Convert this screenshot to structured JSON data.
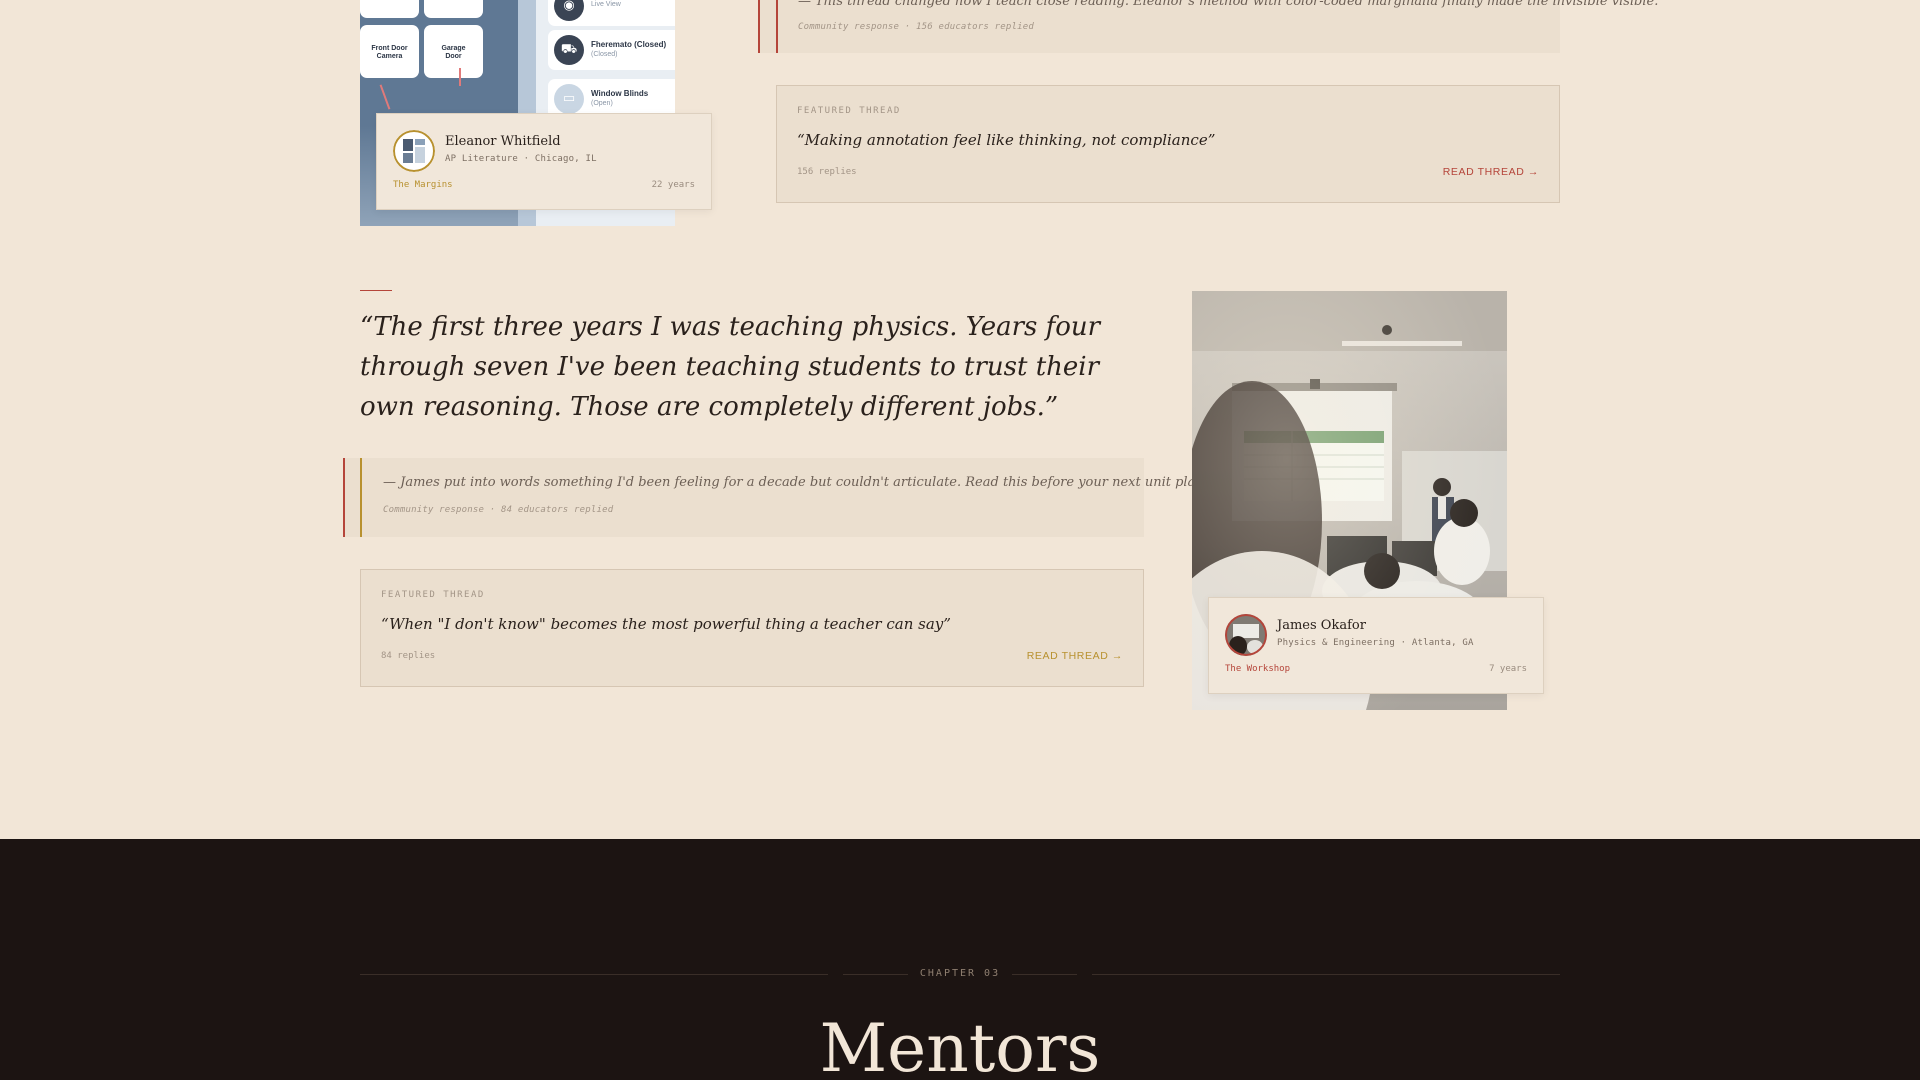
{
  "app_screenshot": {
    "tiles": [
      {
        "label": "Front Door\nCamera"
      },
      {
        "label": "Garage\nDoor"
      }
    ],
    "rows": [
      {
        "icon": "camera-icon",
        "title": "",
        "subtitle": "Live View"
      },
      {
        "icon": "car-icon",
        "title": "Fheremato (Closed)",
        "subtitle": "(Closed)"
      },
      {
        "icon": "blinds-icon",
        "title": "Window Blinds",
        "subtitle": "(Open)"
      }
    ]
  },
  "top_response": {
    "text": "— This thread changed how I teach close reading. Eleanor's method with color-coded marginalia finally made the invisible visible.",
    "sub": "Community response · 156 educators replied"
  },
  "eleanor": {
    "name": "Eleanor Whitfield",
    "meta": "AP Literature · Chicago, IL",
    "group": "The Margins",
    "years": "22 years",
    "accent": "#b8912f"
  },
  "thread_1": {
    "kicker": "FEATURED THREAD",
    "title": "“Making annotation feel like thinking, not compliance”",
    "replies": "156 replies",
    "read": "READ THREAD →",
    "accent": "#b5453a"
  },
  "james_quote": {
    "text": "“The first three years I was teaching physics. Years four through seven I've been teaching students to trust their own reasoning. Those are completely different jobs.”"
  },
  "james_response": {
    "text": "— James put into words something I'd been feeling for a decade but couldn't articulate. Read this before your next unit plan.",
    "sub": "Community response · 84 educators replied"
  },
  "thread_2": {
    "kicker": "FEATURED THREAD",
    "title": "“When \"I don't know\" becomes the most powerful thing a teacher can say”",
    "replies": "84 replies",
    "read": "READ THREAD →",
    "accent": "#b8912f"
  },
  "james": {
    "name": "James Okafor",
    "meta": "Physics & Engineering · Atlanta, GA",
    "group": "The Workshop",
    "years": "7 years",
    "accent": "#b5453a"
  },
  "chapter": {
    "kicker": "CHAPTER 03",
    "title": "Mentors"
  }
}
